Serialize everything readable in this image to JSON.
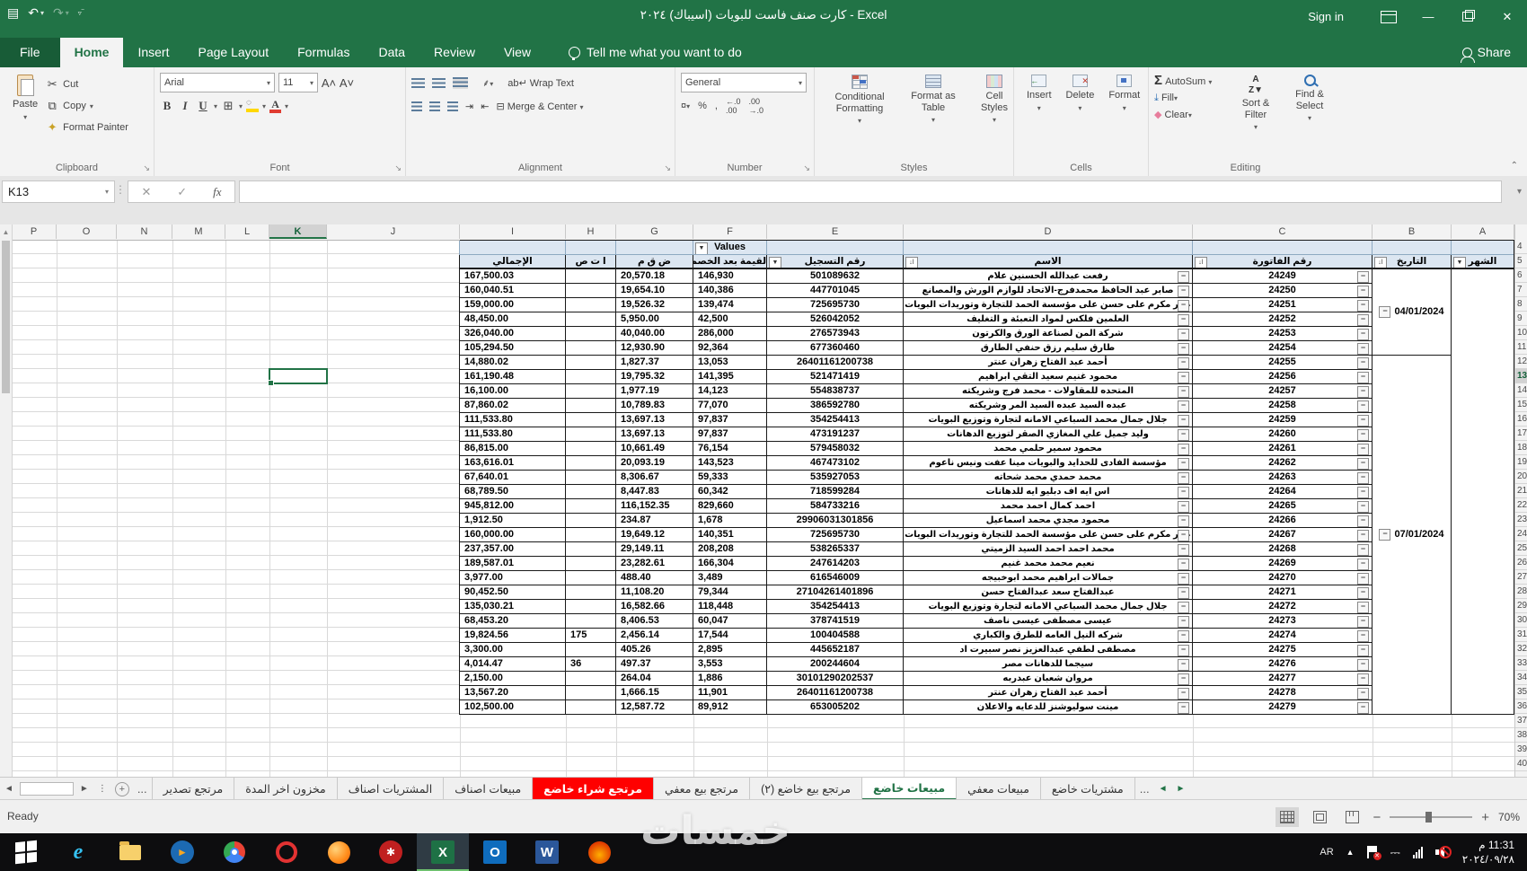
{
  "colors": {
    "excel_green": "#217346",
    "file_green": "#185c37",
    "tab_red": "#ff0000",
    "header_fill": "#dce6f1",
    "selection_green": "#217346"
  },
  "title_bar": {
    "title": "كارت صنف فاست للبويات (اسيباك) ٢٠٢٤  -  Excel",
    "sign_in": "Sign in"
  },
  "quick_access": {
    "save": "save",
    "undo": "undo",
    "redo": "redo",
    "customize": "customize-quick-access"
  },
  "ribbon_tabs": {
    "items": [
      {
        "label": "File",
        "file": true
      },
      {
        "label": "Home",
        "active": true
      },
      {
        "label": "Insert"
      },
      {
        "label": "Page Layout"
      },
      {
        "label": "Formulas"
      },
      {
        "label": "Data"
      },
      {
        "label": "Review"
      },
      {
        "label": "View"
      }
    ],
    "tell_me": "Tell me what you want to do",
    "share": "Share"
  },
  "ribbon": {
    "clipboard": {
      "label": "Clipboard",
      "paste": "Paste",
      "cut": "Cut",
      "copy": "Copy",
      "format_painter": "Format Painter"
    },
    "font": {
      "label": "Font",
      "font_name": "Arial",
      "font_size": "11",
      "bold": "B",
      "italic": "I",
      "underline": "U"
    },
    "alignment": {
      "label": "Alignment",
      "wrap_text": "Wrap Text",
      "merge_center": "Merge & Center"
    },
    "number": {
      "label": "Number",
      "format": "General",
      "percent": "%",
      "comma": ","
    },
    "styles": {
      "label": "Styles",
      "conditional": "Conditional Formatting",
      "format_table": "Format as Table",
      "cell_styles": "Cell Styles"
    },
    "cells": {
      "label": "Cells",
      "insert": "Insert",
      "delete": "Delete",
      "format": "Format"
    },
    "editing": {
      "label": "Editing",
      "autosum": "AutoSum",
      "fill": "Fill",
      "clear": "Clear",
      "sort": "Sort & Filter",
      "find": "Find & Select"
    }
  },
  "formula_bar": {
    "name_box": "K13",
    "formula": ""
  },
  "sheet": {
    "selected_cell": "K13",
    "selected_column": "K",
    "selected_row": 13,
    "column_letters": [
      "P",
      "O",
      "N",
      "M",
      "L",
      "K",
      "J",
      "I",
      "H",
      "G",
      "F",
      "E",
      "D",
      "C",
      "B",
      "A"
    ],
    "first_row_number": 4,
    "last_row_number": 40,
    "table": {
      "values_label": "Values",
      "filter_sort_glyph": "ا↓",
      "filter_dd_glyph": "▼",
      "collapse_glyph": "−",
      "headers": {
        "month": "الشهر",
        "date": "التاريخ",
        "invoice": "رقم الفاتورة",
        "name": "الاسم",
        "reg": "رقم التسجيل",
        "net": "القيمة بعد الخصم",
        "vat": "ض ق م",
        "ats": "ا ت ص",
        "total": "الإجمالي"
      },
      "date_groups": [
        {
          "label": "04/01/2024",
          "start": 1,
          "span": 6
        },
        {
          "label": "07/01/2024",
          "start": 7,
          "span": 25
        }
      ],
      "rows": [
        {
          "inv": "24249",
          "name": "رفعت عبدالله الحسنين علام",
          "reg": "501089632",
          "net": "146,930",
          "vat": "20,570.18",
          "ats": "",
          "total": "167,500.03"
        },
        {
          "inv": "24250",
          "name": "صابر عبد الحافظ محمدفرج-الاتحاد للوازم الورش والمصانع",
          "reg": "447701045",
          "net": "140,386",
          "vat": "19,654.10",
          "ats": "",
          "total": "160,040.51"
        },
        {
          "inv": "24251",
          "name": "عمر مكرم على حسن على مؤسسة الحمد للتجارة وتوريدات البويات",
          "reg": "725695730",
          "net": "139,474",
          "vat": "19,526.32",
          "ats": "",
          "total": "159,000.00"
        },
        {
          "inv": "24252",
          "name": "العلمين فلكس لمواد التعبئة و التغليف",
          "reg": "526042052",
          "net": "42,500",
          "vat": "5,950.00",
          "ats": "",
          "total": "48,450.00"
        },
        {
          "inv": "24253",
          "name": "شركة المن لصناعة الورق والكرتون",
          "reg": "276573943",
          "net": "286,000",
          "vat": "40,040.00",
          "ats": "",
          "total": "326,040.00"
        },
        {
          "inv": "24254",
          "name": "طارق سليم رزق حنفي الطارق",
          "reg": "677360460",
          "net": "92,364",
          "vat": "12,930.90",
          "ats": "",
          "total": "105,294.50"
        },
        {
          "inv": "24255",
          "name": "أحمد عبد الفتاح زهران عنتر",
          "reg": "26401161200738",
          "net": "13,053",
          "vat": "1,827.37",
          "ats": "",
          "total": "14,880.02"
        },
        {
          "inv": "24256",
          "name": "محمود غنيم سعيد التقي ابراهيم",
          "reg": "521471419",
          "net": "141,395",
          "vat": "19,795.32",
          "ats": "",
          "total": "161,190.48"
        },
        {
          "inv": "24257",
          "name": "المتحده للمقاولات - محمد فرج وشريكته",
          "reg": "554838737",
          "net": "14,123",
          "vat": "1,977.19",
          "ats": "",
          "total": "16,100.00"
        },
        {
          "inv": "24258",
          "name": "عبده السيد عبده السيد المر وشريكته",
          "reg": "386592780",
          "net": "77,070",
          "vat": "10,789.83",
          "ats": "",
          "total": "87,860.02"
        },
        {
          "inv": "24259",
          "name": "جلال جمال محمد السباعي الامانه لتجارة وتوزيع البويات",
          "reg": "354254413",
          "net": "97,837",
          "vat": "13,697.13",
          "ats": "",
          "total": "111,533.80"
        },
        {
          "inv": "24260",
          "name": "وليد جميل علي المغازي الصقر لتوزيع الدهانات",
          "reg": "473191237",
          "net": "97,837",
          "vat": "13,697.13",
          "ats": "",
          "total": "111,533.80"
        },
        {
          "inv": "24261",
          "name": "محمود سمير حلمي محمد",
          "reg": "579458032",
          "net": "76,154",
          "vat": "10,661.49",
          "ats": "",
          "total": "86,815.00"
        },
        {
          "inv": "24262",
          "name": "مؤسسة الفادى للحدايد والبويات مينا عفت ونيس ناعوم",
          "reg": "467473102",
          "net": "143,523",
          "vat": "20,093.19",
          "ats": "",
          "total": "163,616.01"
        },
        {
          "inv": "24263",
          "name": "محمد حمدي محمد شحاته",
          "reg": "535927053",
          "net": "59,333",
          "vat": "8,306.67",
          "ats": "",
          "total": "67,640.01"
        },
        {
          "inv": "24264",
          "name": "اس ايه اف دبليو ايه للدهانات",
          "reg": "718599284",
          "net": "60,342",
          "vat": "8,447.83",
          "ats": "",
          "total": "68,789.50"
        },
        {
          "inv": "24265",
          "name": "احمد كمال احمد محمد",
          "reg": "584733216",
          "net": "829,660",
          "vat": "116,152.35",
          "ats": "",
          "total": "945,812.00"
        },
        {
          "inv": "24266",
          "name": "محمود مجدي محمد اسماعيل",
          "reg": "29906031301856",
          "net": "1,678",
          "vat": "234.87",
          "ats": "",
          "total": "1,912.50"
        },
        {
          "inv": "24267",
          "name": "عمر مكرم على حسن على مؤسسة الحمد للتجارة وتوريدات البويات",
          "reg": "725695730",
          "net": "140,351",
          "vat": "19,649.12",
          "ats": "",
          "total": "160,000.00"
        },
        {
          "inv": "24268",
          "name": "محمد احمد احمد السيد الزميتي",
          "reg": "538265337",
          "net": "208,208",
          "vat": "29,149.11",
          "ats": "",
          "total": "237,357.00"
        },
        {
          "inv": "24269",
          "name": "نعيم محمد محمد غنيم",
          "reg": "247614203",
          "net": "166,304",
          "vat": "23,282.61",
          "ats": "",
          "total": "189,587.01"
        },
        {
          "inv": "24270",
          "name": "جمالات ابراهيم محمد ابوخبيجه",
          "reg": "616546009",
          "net": "3,489",
          "vat": "488.40",
          "ats": "",
          "total": "3,977.00"
        },
        {
          "inv": "24271",
          "name": "عبدالفتاح سعد عبدالفتاح حسن",
          "reg": "27104261401896",
          "net": "79,344",
          "vat": "11,108.20",
          "ats": "",
          "total": "90,452.50"
        },
        {
          "inv": "24272",
          "name": "جلال جمال محمد السباعي الامانه لتجارة وتوزيع البويات",
          "reg": "354254413",
          "net": "118,448",
          "vat": "16,582.66",
          "ats": "",
          "total": "135,030.21"
        },
        {
          "inv": "24273",
          "name": "عيسى مصطفى عيسى ناصف",
          "reg": "378741519",
          "net": "60,047",
          "vat": "8,406.53",
          "ats": "",
          "total": "68,453.20"
        },
        {
          "inv": "24274",
          "name": "شركه النيل العامه للطرق والكباري",
          "reg": "100404588",
          "net": "17,544",
          "vat": "2,456.14",
          "ats": "175",
          "total": "19,824.56"
        },
        {
          "inv": "24275",
          "name": "مصطفى لطفي عبدالعزيز نصر سبيرت اد",
          "reg": "445652187",
          "net": "2,895",
          "vat": "405.26",
          "ats": "",
          "total": "3,300.00"
        },
        {
          "inv": "24276",
          "name": "سيجما للدهانات مصر",
          "reg": "200244604",
          "net": "3,553",
          "vat": "497.37",
          "ats": "36",
          "total": "4,014.47"
        },
        {
          "inv": "24277",
          "name": "مروان شعبان عبدربه",
          "reg": "30101290202537",
          "net": "1,886",
          "vat": "264.04",
          "ats": "",
          "total": "2,150.00"
        },
        {
          "inv": "24278",
          "name": "أحمد عبد الفتاح زهران عنتر",
          "reg": "26401161200738",
          "net": "11,901",
          "vat": "1,666.15",
          "ats": "",
          "total": "13,567.20"
        },
        {
          "inv": "24279",
          "name": "مينت سوليوشنز للدعايه والاعلان",
          "reg": "653005202",
          "net": "89,912",
          "vat": "12,587.72",
          "ats": "",
          "total": "102,500.00"
        }
      ]
    }
  },
  "sheet_tabs": {
    "left_overflow": "...",
    "right_overflow": "...",
    "tabs": [
      {
        "label": "مرتجع تصدير"
      },
      {
        "label": "مخزون اخر المدة"
      },
      {
        "label": "المشتريات اصناف"
      },
      {
        "label": "مبيعات اصناف"
      },
      {
        "label": "مرتجع شراء خاضع",
        "red": true
      },
      {
        "label": "مرتجع بيع معفي"
      },
      {
        "label": "مرتجع بيع خاضع (٢)"
      },
      {
        "label": "مبيعات خاضع",
        "active": true
      },
      {
        "label": "مبيعات معفي"
      },
      {
        "label": "مشتريات خاضع"
      }
    ]
  },
  "status_bar": {
    "ready": "Ready",
    "zoom": "70%"
  },
  "taskbar": {
    "language": "AR",
    "time": "11:31 م",
    "date": "٢٠٢٤/٠٩/٢٨",
    "icons": [
      {
        "name": "start-button"
      },
      {
        "name": "internet-explorer-icon"
      },
      {
        "name": "file-explorer-icon"
      },
      {
        "name": "media-player-icon"
      },
      {
        "name": "chrome-icon"
      },
      {
        "name": "opera-icon"
      },
      {
        "name": "firefox-icon"
      },
      {
        "name": "red-app-icon"
      },
      {
        "name": "excel-taskbar-icon",
        "active": true
      },
      {
        "name": "outlook-icon"
      },
      {
        "name": "word-icon"
      },
      {
        "name": "flame-app-icon"
      }
    ]
  },
  "watermark": "خمسات"
}
